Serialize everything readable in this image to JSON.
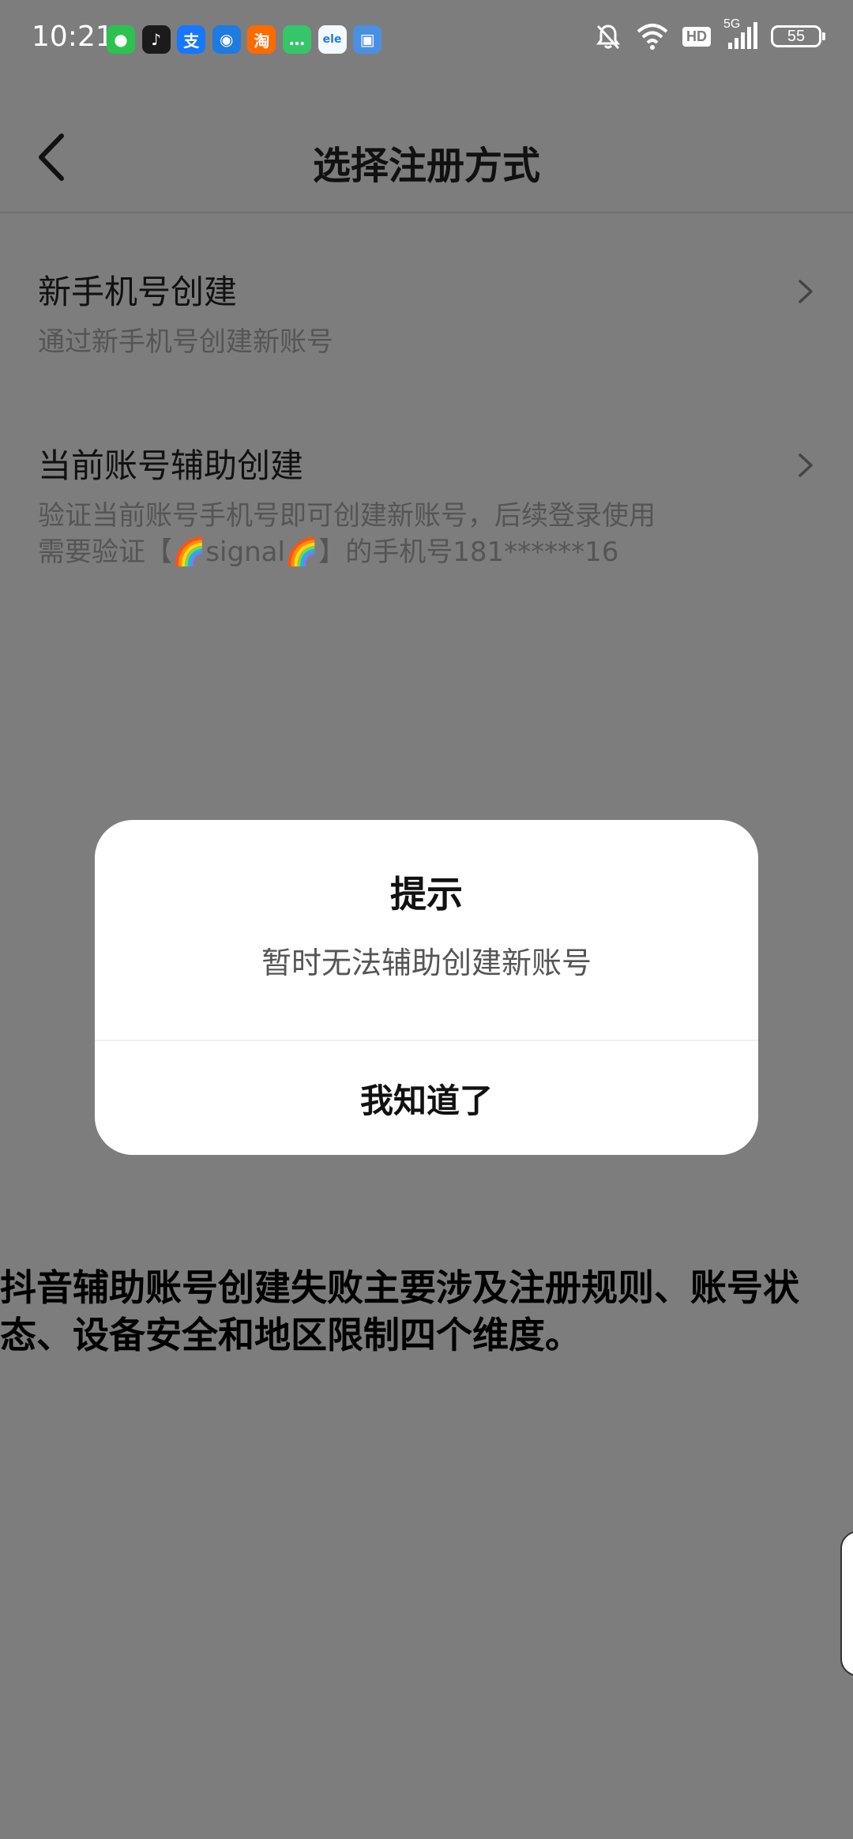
{
  "status_bar": {
    "time": "10:21",
    "notification_apps": [
      {
        "icon": "wechat-icon",
        "glyph": "●",
        "color": "#2BC24E"
      },
      {
        "icon": "douyin-icon",
        "glyph": "♪",
        "color": "#1b1b1b"
      },
      {
        "icon": "alipay-icon",
        "glyph": "支",
        "color": "#1677FF"
      },
      {
        "icon": "qq-icon",
        "glyph": "◉",
        "color": "#1e7be0"
      },
      {
        "icon": "taobao-icon",
        "glyph": "淘",
        "color": "#FF6A00"
      },
      {
        "icon": "message-icon",
        "glyph": "…",
        "color": "#35c66a"
      },
      {
        "icon": "ele-icon",
        "glyph": "ele",
        "color": "#f4f8ff"
      },
      {
        "icon": "clipboard-app-icon",
        "glyph": "▣",
        "color": "#4a90e2"
      }
    ],
    "hd_label": "HD",
    "network_label": "5G",
    "battery_level": "55"
  },
  "header": {
    "title": "选择注册方式"
  },
  "options": [
    {
      "title": "新手机号创建",
      "description_lines": [
        "通过新手机号创建新账号"
      ]
    },
    {
      "title": "当前账号辅助创建",
      "description_lines": [
        "验证当前账号手机号即可创建新账号，后续登录使用",
        "需要验证【🌈signal🌈】的手机号181******16"
      ]
    }
  ],
  "dialog": {
    "title": "提示",
    "message": "暂时无法辅助创建新账号",
    "button_label": "我知道了"
  },
  "caption": "抖音辅助账号创建失败主要涉及注册规则、账号状态、设备安全和地区限制四个维度。"
}
